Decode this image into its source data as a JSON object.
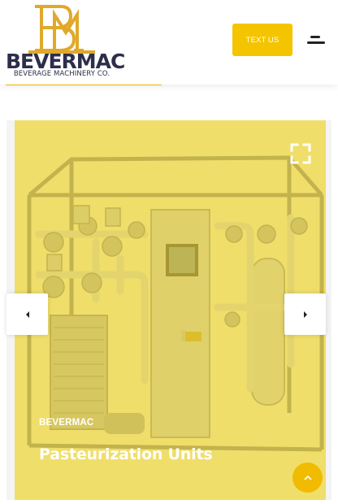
{
  "header": {
    "logo": {
      "monogram": "BM",
      "name": "BEVERMAC",
      "tagline": "BEVERAGE MACHINERY CO."
    },
    "text_us_label": "TEXT US",
    "menu_icon": "hamburger-menu-icon"
  },
  "slider": {
    "current_slide": {
      "brand": "BEVERMAC",
      "title": "Pasteurization Units",
      "image": "pasteurization-unit-machine"
    },
    "prev_icon": "caret-left-icon",
    "next_icon": "caret-right-icon",
    "expand_icon": "fullscreen-expand-icon"
  },
  "scroll_top_icon": "chevron-up-icon",
  "colors": {
    "accent": "#f5c400",
    "logo_gold": "#e0a92a",
    "logo_navy": "#2d2e4a",
    "overlay": "#f2d61e"
  }
}
